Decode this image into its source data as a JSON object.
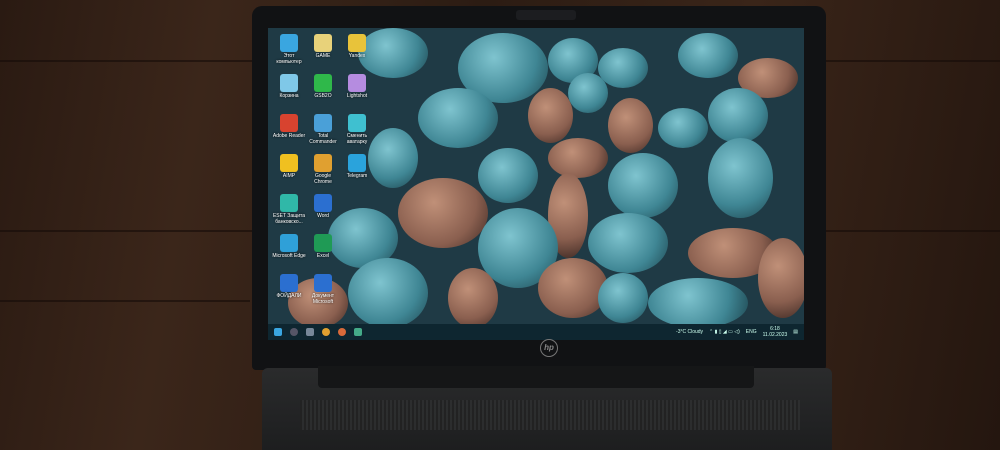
{
  "desktop": {
    "icons": [
      {
        "label": "Этот компьютер",
        "color": "#3aa6e0"
      },
      {
        "label": "GAME",
        "color": "#e8d27a"
      },
      {
        "label": "Yandex",
        "color": "#e8c33a"
      },
      {
        "label": "Корзина",
        "color": "#7fc8e8"
      },
      {
        "label": "GSB2O",
        "color": "#2fb84a"
      },
      {
        "label": "Lightshot",
        "color": "#b58ce0"
      },
      {
        "label": "Adobe Reader",
        "color": "#d8432f"
      },
      {
        "label": "Total Commander",
        "color": "#4aa0d8"
      },
      {
        "label": "Сменить аватарку",
        "color": "#3fc0d0"
      },
      {
        "label": "AIMP",
        "color": "#f0c020"
      },
      {
        "label": "Google Chrome",
        "color": "#e0a030"
      },
      {
        "label": "Telegram",
        "color": "#2aa3dc"
      },
      {
        "label": "ESET Защита банковско...",
        "color": "#30b8a8"
      },
      {
        "label": "Word",
        "color": "#2b6fd0"
      },
      {
        "label": "",
        "color": "#000000"
      },
      {
        "label": "Microsoft Edge",
        "color": "#2fa0d8"
      },
      {
        "label": "Excel",
        "color": "#1f9a55"
      },
      {
        "label": "",
        "color": "#000000"
      },
      {
        "label": "ФОЙДАЛИ",
        "color": "#2b6fd0"
      },
      {
        "label": "Документ Microsoft",
        "color": "#2b6fd0"
      }
    ]
  },
  "taskbar": {
    "weather": "-3°C  Cloudy",
    "language": "ENG",
    "time": "6:18",
    "date": "11.02.2023"
  },
  "brand": "hp"
}
